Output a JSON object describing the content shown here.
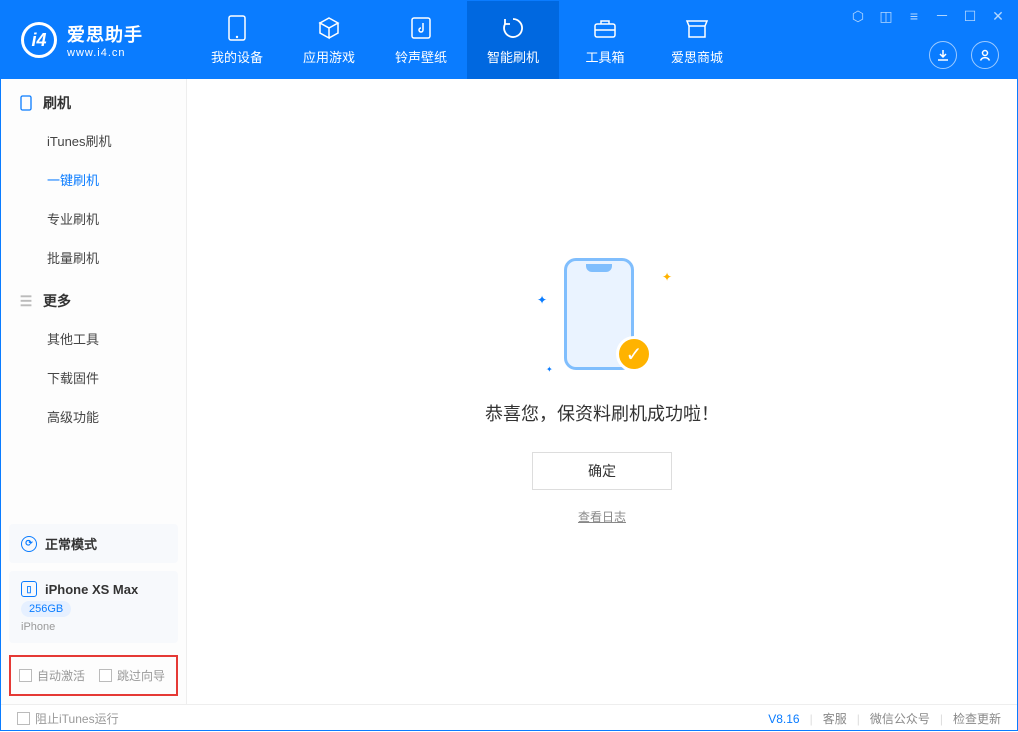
{
  "app": {
    "title": "爱思助手",
    "domain": "www.i4.cn"
  },
  "nav": {
    "tabs": [
      {
        "label": "我的设备"
      },
      {
        "label": "应用游戏"
      },
      {
        "label": "铃声壁纸"
      },
      {
        "label": "智能刷机"
      },
      {
        "label": "工具箱"
      },
      {
        "label": "爱思商城"
      }
    ]
  },
  "sidebar": {
    "group1": {
      "title": "刷机",
      "items": [
        "iTunes刷机",
        "一键刷机",
        "专业刷机",
        "批量刷机"
      ]
    },
    "group2": {
      "title": "更多",
      "items": [
        "其他工具",
        "下载固件",
        "高级功能"
      ]
    }
  },
  "device": {
    "mode": "正常模式",
    "name": "iPhone XS Max",
    "storage": "256GB",
    "type": "iPhone"
  },
  "options": {
    "auto_activate": "自动激活",
    "skip_guide": "跳过向导"
  },
  "main": {
    "success": "恭喜您，保资料刷机成功啦！",
    "confirm": "确定",
    "view_log": "查看日志"
  },
  "bottom": {
    "block_itunes": "阻止iTunes运行",
    "version": "V8.16",
    "support": "客服",
    "wechat": "微信公众号",
    "update": "检查更新"
  }
}
